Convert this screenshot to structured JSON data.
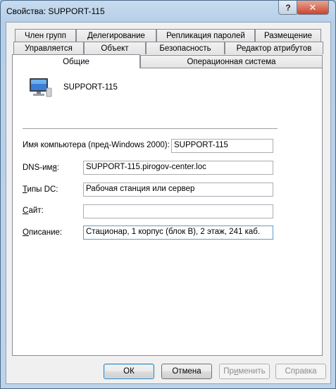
{
  "window": {
    "title": "Свойства: SUPPORT-115",
    "help_glyph": "?",
    "close_glyph": "✕"
  },
  "tabs": {
    "row1": [
      "Член групп",
      "Делегирование",
      "Репликация паролей",
      "Размещение"
    ],
    "row2": [
      "Управляется",
      "Объект",
      "Безопасность",
      "Редактор атрибутов"
    ],
    "row3": [
      "Общие",
      "Операционная система"
    ],
    "active": "Общие"
  },
  "general": {
    "computer_name": "SUPPORT-115",
    "pre2000_label": "Имя компьютера (пред-Windows 2000):",
    "pre2000_value": "SUPPORT-115",
    "dns_label_before": "DNS-им",
    "dns_label_ul": "я",
    "dns_label_after": ":",
    "dns_value": "SUPPORT-115.pirogov-center.loc",
    "dc_label_ul": "Т",
    "dc_label_after": "ипы DC:",
    "dc_value": "Рабочая станция или сервер",
    "site_label_ul": "С",
    "site_label_after": "айт:",
    "site_value": "",
    "desc_label_ul": "О",
    "desc_label_after": "писание:",
    "desc_value": "Стационар, 1 корпус (блок В), 2 этаж, 241 каб."
  },
  "buttons": {
    "ok": "ОК",
    "cancel": "Отмена",
    "apply_before": "Пр",
    "apply_ul": "и",
    "apply_after": "менить",
    "help": "Справка"
  }
}
